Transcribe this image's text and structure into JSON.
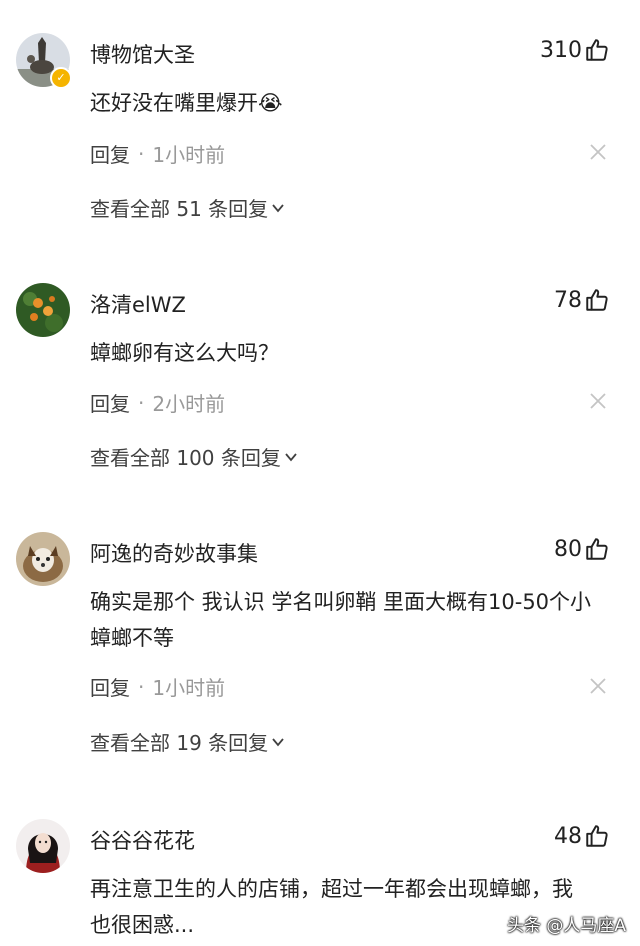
{
  "comments": [
    {
      "username": "博物馆大圣",
      "likes": "310",
      "text": "还好没在嘴里爆开😭",
      "reply_label": "回复",
      "separator": "·",
      "time": "1小时前",
      "view_all": "查看全部 51 条回复"
    },
    {
      "username": "洛清elWZ",
      "likes": "78",
      "text": "蟑螂卵有这么大吗？",
      "reply_label": "回复",
      "separator": "·",
      "time": "2小时前",
      "view_all": "查看全部 100 条回复"
    },
    {
      "username": "阿逸的奇妙故事集",
      "likes": "80",
      "text": "确实是那个 我认识 学名叫卵鞘 里面大概有10-50个小蟑螂不等",
      "reply_label": "回复",
      "separator": "·",
      "time": "1小时前",
      "view_all": "查看全部 19 条回复"
    },
    {
      "username": "谷谷谷花花",
      "likes": "48",
      "text": "再注意卫生的人的店铺，超过一年都会出现蟑螂，我也很困惑...",
      "reply_label": "",
      "separator": "",
      "time": "",
      "view_all": ""
    }
  ],
  "watermark": "头条 @人马座A",
  "icons": {
    "like": "thumbs-up-icon",
    "close": "close-icon",
    "expand": "chevron-down-icon",
    "verified": "verified-badge-icon"
  },
  "colors": {
    "text": "#222222",
    "meta": "#999999",
    "verified": "#f5b400"
  }
}
